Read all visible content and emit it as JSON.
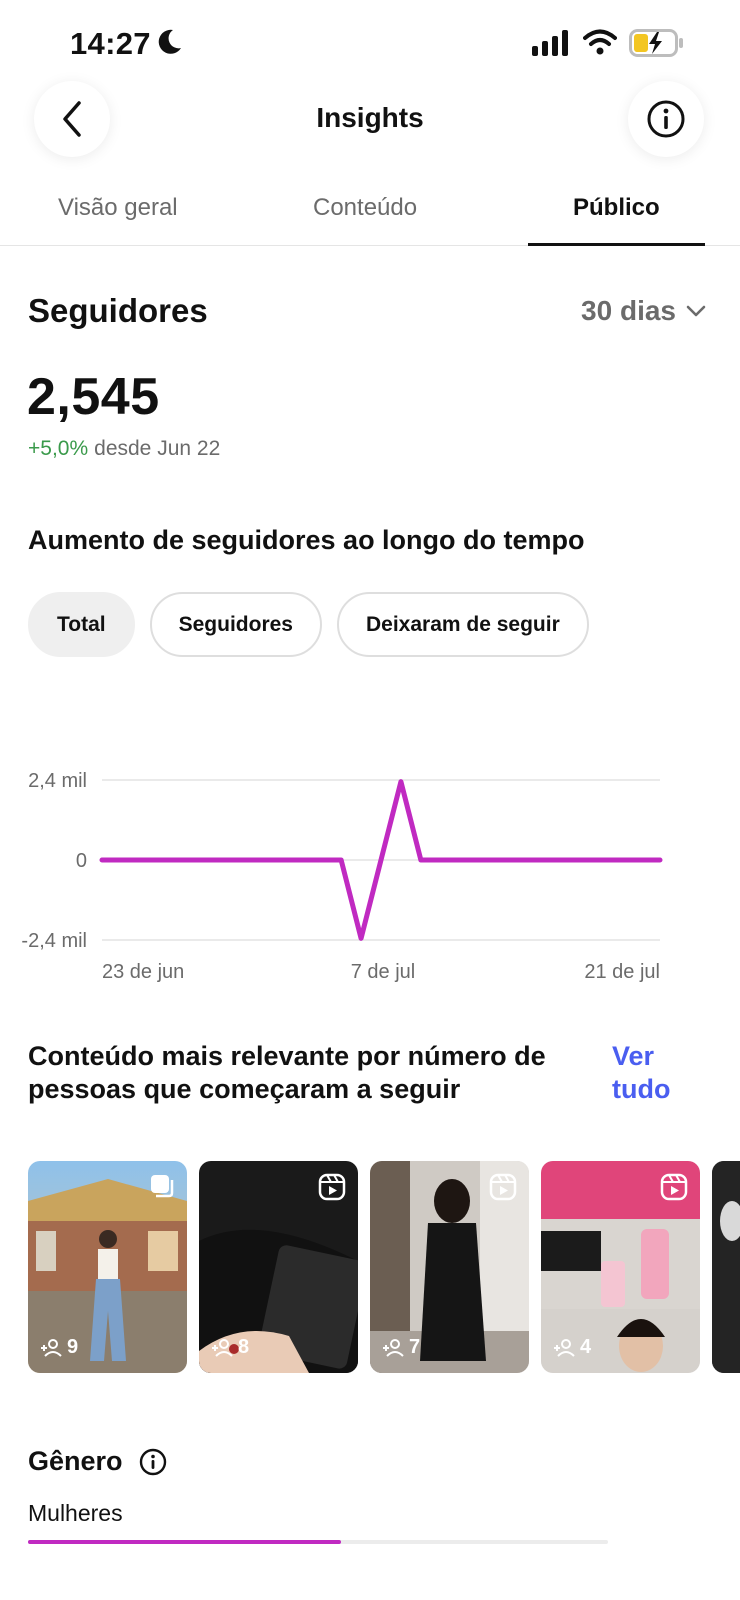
{
  "status_bar": {
    "time": "14:27",
    "icons": [
      "moon-icon",
      "cellular-signal-icon",
      "wifi-icon",
      "battery-charging-icon"
    ]
  },
  "header": {
    "title": "Insights",
    "back_icon": "chevron-left-icon",
    "info_icon": "info-icon"
  },
  "tabs": [
    {
      "label": "Visão geral",
      "active": false
    },
    {
      "label": "Conteúdo",
      "active": false
    },
    {
      "label": "Público",
      "active": true
    }
  ],
  "followers": {
    "title": "Seguidores",
    "range": "30 dias",
    "count": "2,545",
    "delta_pct": "+5,0%",
    "delta_since": "desde Jun 22"
  },
  "growth": {
    "heading": "Aumento de seguidores ao longo do tempo",
    "chips": [
      {
        "label": "Total",
        "active": true
      },
      {
        "label": "Seguidores",
        "active": false
      },
      {
        "label": "Deixaram de seguir",
        "active": false
      }
    ]
  },
  "chart_data": {
    "type": "line",
    "ylabel_ticks": [
      "2,4 mil",
      "0",
      "-2,4 mil"
    ],
    "y_ticks": [
      2400,
      0,
      -2400
    ],
    "ylim": [
      -2400,
      2400
    ],
    "x_ticks": [
      "23 de jun",
      "7 de jul",
      "21 de jul"
    ],
    "series": [
      {
        "color": "#c02ac1",
        "x": [
          "2023-06-23",
          "2023-07-05",
          "2023-07-06",
          "2023-07-08",
          "2023-07-09",
          "2023-07-21"
        ],
        "values": [
          0,
          0,
          -2350,
          2350,
          0,
          0
        ]
      }
    ],
    "grid": true
  },
  "top_content": {
    "heading": "Conteúdo mais relevante por número de pessoas que começaram a seguir",
    "see_all": "Ver tudo",
    "items": [
      {
        "type": "carousel",
        "followers": "9"
      },
      {
        "type": "reel",
        "followers": "8"
      },
      {
        "type": "reel",
        "followers": "7"
      },
      {
        "type": "reel",
        "followers": "4"
      }
    ]
  },
  "gender": {
    "title": "Gênero",
    "women_label": "Mulheres",
    "women_share": 0.54
  },
  "colors": {
    "accent_line": "#c02ac1",
    "link": "#4a5ef0",
    "positive": "#3a9a4b"
  }
}
